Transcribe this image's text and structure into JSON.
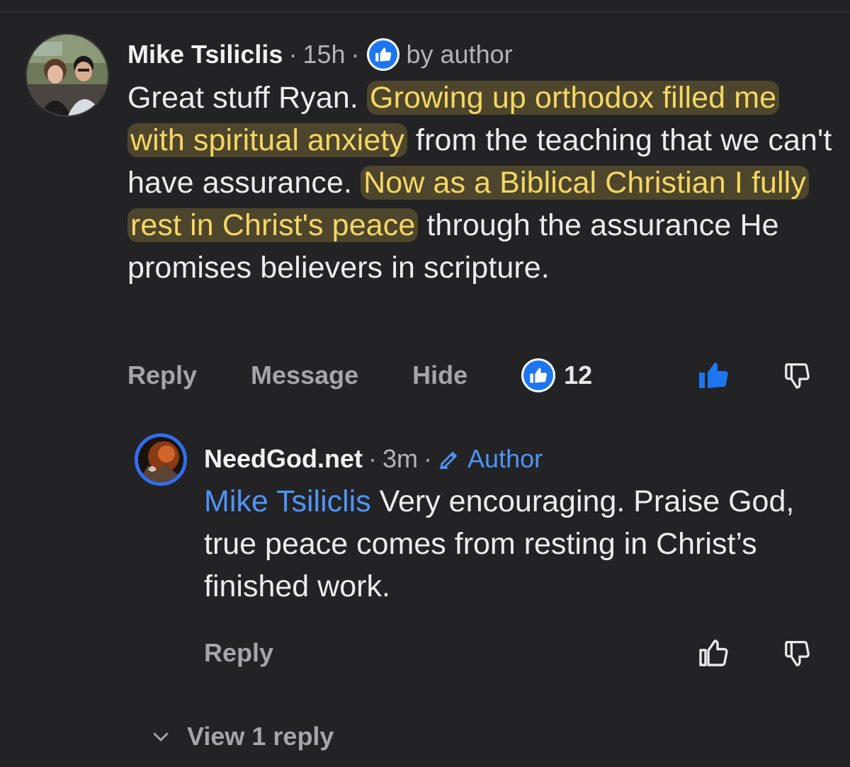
{
  "comment": {
    "author": "Mike Tsiliclis",
    "time": "15h",
    "dot": "·",
    "liked_by_author_label": "by author",
    "body_segments": [
      {
        "text": "Great stuff Ryan. ",
        "highlight": false
      },
      {
        "text": "Growing up orthodox filled me with spiritual anxiety",
        "highlight": true
      },
      {
        "text": " from the teaching that we can't have assurance. ",
        "highlight": false
      },
      {
        "text": "Now as a Biblical Christian I fully rest in Christ's peace",
        "highlight": true
      },
      {
        "text": " through the assurance He promises believers in scripture.",
        "highlight": false
      }
    ],
    "actions": {
      "reply": "Reply",
      "message": "Message",
      "hide": "Hide",
      "like_count": "12"
    },
    "liked": true
  },
  "reply": {
    "author": "NeedGod.net",
    "time": "3m",
    "dot": "·",
    "author_tag": "Author",
    "mention": "Mike Tsiliclis",
    "body": " Very encouraging. Praise God, true peace comes from resting in Christ’s finished work.",
    "actions": {
      "reply": "Reply"
    },
    "liked": false
  },
  "view_replies_label": "View 1 reply",
  "colors": {
    "background": "#232325",
    "accent_blue": "#1d76f0",
    "link_blue": "#4e94f7",
    "highlight_text": "#f4d663",
    "muted": "#a4a4aa"
  },
  "icons": {
    "like_badge": "thumbs-up-icon",
    "thumb_up": "thumb-up-icon",
    "thumb_down": "thumb-down-icon",
    "author_tag": "pencil-icon",
    "view_replies": "chevron-down-icon"
  }
}
